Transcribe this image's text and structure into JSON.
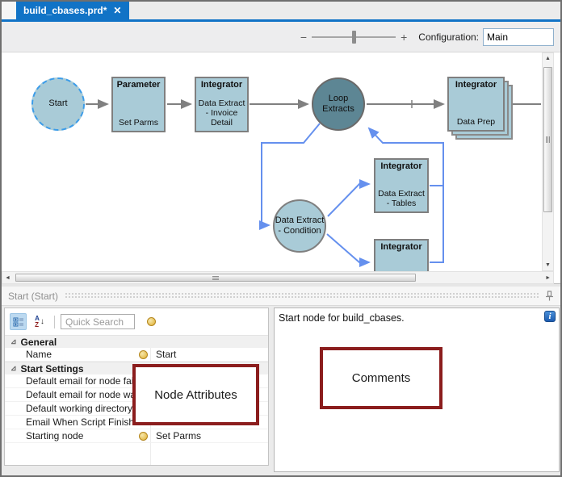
{
  "tab_bar": {
    "tab": {
      "label": "build_cbases.prd*",
      "close_glyph": "✕"
    }
  },
  "toolbar": {
    "zoom_out_glyph": "−",
    "zoom_in_glyph": "+",
    "configuration_label": "Configuration:",
    "configuration_value": "Main"
  },
  "canvas": {
    "nodes": {
      "start": {
        "label": "Start"
      },
      "parameter": {
        "type": "Parameter",
        "name": "Set Parms"
      },
      "integrator_invoice": {
        "type": "Integrator",
        "name": "Data Extract - Invoice Detail"
      },
      "loop_extracts": {
        "label": "Loop Extracts"
      },
      "integrator_data_prep": {
        "type": "Integrator",
        "name": "Data Prep"
      },
      "condition": {
        "label": "Data Extract - Condition"
      },
      "integrator_tables": {
        "type": "Integrator",
        "name": "Data Extract - Tables"
      },
      "integrator_partial": {
        "type": "Integrator"
      }
    },
    "colors": {
      "node_fill": "#a9cbd7",
      "loop_fill": "#5d8694",
      "connector_gray": "#808080",
      "connector_blue": "#6590ee",
      "start_dash_blue": "#3c9ce8"
    }
  },
  "pane_header": {
    "label": "Start (Start)"
  },
  "attributes_panel": {
    "search_placeholder": "Quick Search",
    "sort_icon": {
      "a": "A",
      "z": "Z",
      "arrow": "↓"
    },
    "rows": [
      {
        "label": "General",
        "category": true
      },
      {
        "label": "Name",
        "value": "Start"
      },
      {
        "label": "Start Settings",
        "category": true
      },
      {
        "label": "Default email for node failure"
      },
      {
        "label": "Default email for node warning"
      },
      {
        "label": "Default working directory"
      },
      {
        "label": "Email When Script Finishes"
      },
      {
        "label": "Starting node",
        "value": "Set Parms"
      }
    ],
    "overlay_label": "Node Attributes"
  },
  "comments_panel": {
    "text": "Start node for build_cbases.",
    "info_glyph": "i",
    "overlay_label": "Comments"
  },
  "colors": {
    "accent_blue": "#1173c6",
    "annotation_maroon": "#8b1d1d"
  }
}
